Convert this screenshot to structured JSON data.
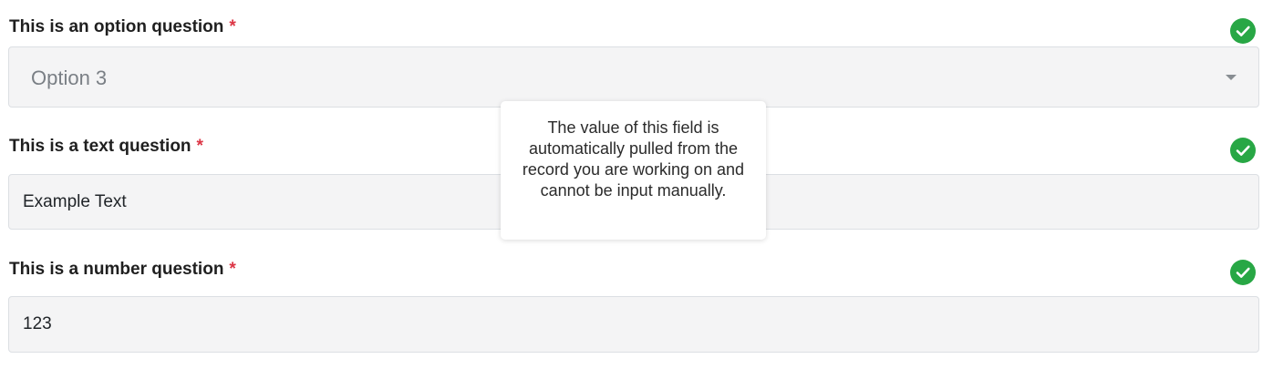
{
  "colors": {
    "required_asterisk": "#dc3545",
    "valid_check": "#28a745",
    "field_background": "#f4f4f5",
    "field_border": "#dcdfe3"
  },
  "questions": [
    {
      "label": "This is an option question",
      "required_mark": "*",
      "type": "select",
      "value": "Option 3",
      "status_icon": "check-circle-icon",
      "dropdown_icon": "caret-down-icon"
    },
    {
      "label": "This is a text question",
      "required_mark": "*",
      "type": "text",
      "value": "Example Text",
      "status_icon": "check-circle-icon"
    },
    {
      "label": "This is a number question",
      "required_mark": "*",
      "type": "number",
      "value": "123",
      "status_icon": "check-circle-icon"
    }
  ],
  "tooltip": {
    "text": "The value of this field is automatically pulled from the record you are working on and cannot be input manually."
  }
}
